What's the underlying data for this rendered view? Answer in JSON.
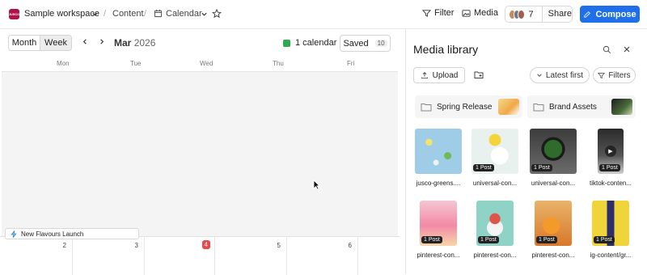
{
  "topbar": {
    "workspace_logo": "JUSCO",
    "workspace_name": "Sample workspace",
    "breadcrumb_content": "Content",
    "breadcrumb_calendar": "Calendar",
    "filter_label": "Filter",
    "media_label": "Media",
    "collaborator_count": "7",
    "share_label": "Share",
    "compose_label": "Compose",
    "compose_color": "#1f6feb"
  },
  "calendar": {
    "view_month": "Month",
    "view_week": "Week",
    "month": "Mar",
    "year": "2026",
    "calendar_count": "1 calendar",
    "saved_label": "Saved",
    "saved_count": "10",
    "weekdays": [
      "Mon",
      "Tue",
      "Wed",
      "Thu",
      "Fri"
    ],
    "day_numbers": [
      "2",
      "3",
      "4",
      "5",
      "6"
    ],
    "today": "4",
    "event_label": "New Flavours Launch",
    "today_color": "#e5484d",
    "calendar_color": "#2fa84f"
  },
  "media_library": {
    "title": "Media library",
    "upload_label": "Upload",
    "sort_label": "Latest first",
    "filters_label": "Filters",
    "folders": [
      "Spring Release",
      "Brand Assets"
    ],
    "items": [
      {
        "label": "jusco-greens....",
        "badge": ""
      },
      {
        "label": "universal-con...",
        "badge": "1 Post"
      },
      {
        "label": "universal-con...",
        "badge": "1 Post"
      },
      {
        "label": "tiktok-conten...",
        "badge": "1 Post"
      },
      {
        "label": "pinterest-con...",
        "badge": "1 Post"
      },
      {
        "label": "pinterest-con...",
        "badge": "1 Post"
      },
      {
        "label": "pinterest-con...",
        "badge": "1 Post"
      },
      {
        "label": "ig-content/gr...",
        "badge": "1 Post"
      }
    ]
  }
}
